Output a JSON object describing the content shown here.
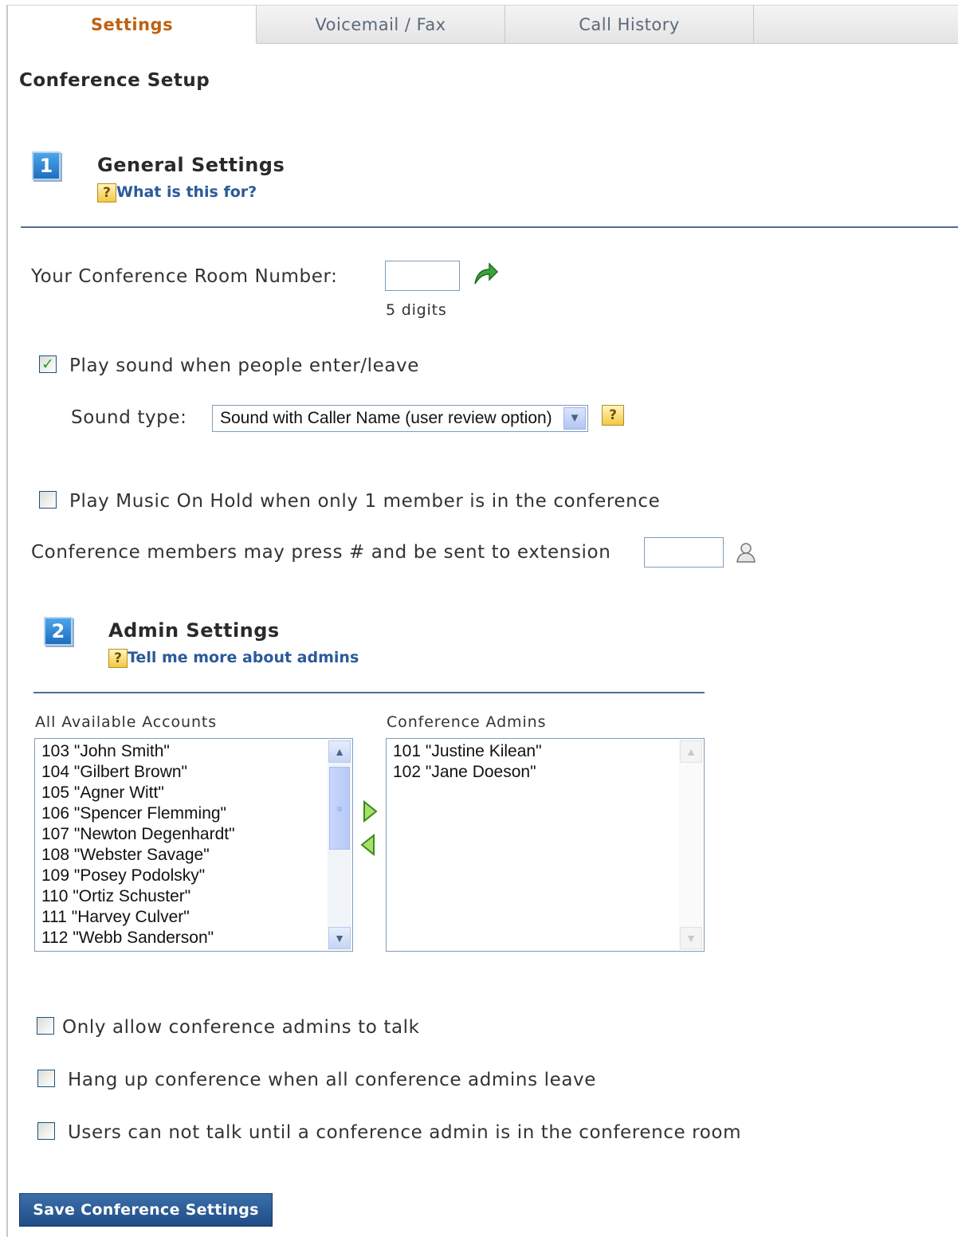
{
  "tabs": [
    {
      "label": "Settings",
      "active": true
    },
    {
      "label": "Voicemail / Fax",
      "active": false
    },
    {
      "label": "Call History",
      "active": false
    },
    {
      "label": "",
      "active": false
    }
  ],
  "page": {
    "title": "Conference Setup"
  },
  "general": {
    "step": "1",
    "heading": "General Settings",
    "help_link": "What is this for?",
    "room_label": "Your Conference Room Number:",
    "room_value": "",
    "room_hint": "5 digits",
    "play_sound_label": "Play sound when people enter/leave",
    "play_sound_checked": true,
    "sound_type_label": "Sound type:",
    "sound_type_value": "Sound with Caller Name (user review option)",
    "moh_label": "Play Music On Hold when only 1 member is in the conference",
    "moh_checked": false,
    "press_hash_label": "Conference members may press # and be sent to extension",
    "press_hash_value": ""
  },
  "admin": {
    "step": "2",
    "heading": "Admin Settings",
    "help_link": "Tell me more about admins",
    "available_label": "All Available Accounts",
    "admins_label": "Conference Admins",
    "available_accounts": [
      "103 \"John Smith\"",
      "104 \"Gilbert Brown\"",
      "105 \"Agner Witt\"",
      "106 \"Spencer Flemming\"",
      "107 \"Newton Degenhardt\"",
      "108 \"Webster Savage\"",
      "109 \"Posey Podolsky\"",
      "110 \"Ortiz Schuster\"",
      "111 \"Harvey Culver\"",
      "112 \"Webb Sanderson\""
    ],
    "conference_admins": [
      "101 \"Justine Kilean\"",
      "102 \"Jane Doeson\""
    ],
    "only_admins_talk_label": "Only allow conference admins to talk",
    "hangup_label": "Hang up conference when all conference admins leave",
    "wait_admin_label": "Users can not talk until a conference admin is in the conference room"
  },
  "save_label": "Save Conference Settings",
  "colors": {
    "accent": "#c06010",
    "link": "#2a5a9a",
    "rule": "#4d6f99",
    "button": "#1f4c86"
  },
  "icons": [
    "help-icon",
    "undo-arrow-icon",
    "user-lookup-icon",
    "move-right-icon",
    "move-left-icon"
  ]
}
